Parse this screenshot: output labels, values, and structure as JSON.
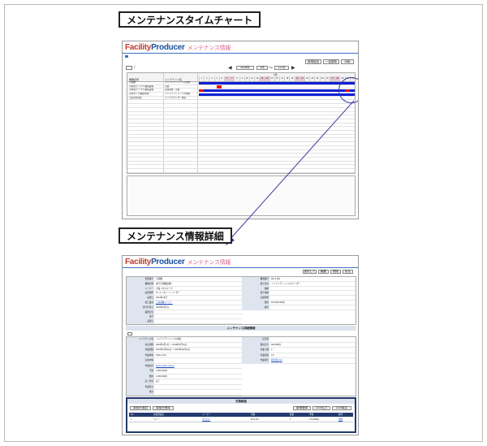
{
  "section1_title": "メンテナンスタイムチャート",
  "section2_title": "メンテナンス情報詳細",
  "app": {
    "brand_a": "Facility",
    "brand_b": "Producer",
    "subtitle": "メンテナンス情報"
  },
  "chart": {
    "buttons": [
      "新規追加",
      "一括更新",
      "印刷"
    ],
    "nav_prev": "◀",
    "nav_next": "▶",
    "year": "2016年",
    "month": "3月",
    "span": "1ヶ月",
    "col_head_name": "機器名称",
    "col_head_type": "メンテナンス名",
    "month_label": "3月",
    "days": [
      "1",
      "2",
      "3",
      "4",
      "5",
      "6",
      "7",
      "8",
      "9",
      "10",
      "11",
      "12",
      "13",
      "14",
      "15",
      "16",
      "17",
      "18",
      "19",
      "20",
      "21",
      "22",
      "23",
      "24",
      "25",
      "26",
      "27",
      "28",
      "29",
      "30",
      "31"
    ],
    "rows": [
      {
        "name": "空調機",
        "type": "インテリアトレッドの交換"
      },
      {
        "name": "冷却塔(アンプル)循環設備",
        "type": "点検"
      },
      {
        "name": "冷却塔(アンプル)循環設備",
        "type": "定期清掃・点検"
      },
      {
        "name": "冷水ポンプ(補給水用)",
        "type": "インテリアトレッドの交換"
      },
      {
        "name": "空調冷却熱源",
        "type": "ライブカウンター交換"
      }
    ]
  },
  "detail": {
    "buttons": [
      "保存して",
      "編集",
      "削除",
      "戻る"
    ],
    "fields_left": [
      {
        "label": "管理番号",
        "value": "空調機"
      },
      {
        "label": "機器名称",
        "value": "本庁空調機設備2"
      },
      {
        "label": "メーカー",
        "value": "大和ハウスワーク"
      },
      {
        "label": "設置場所",
        "value": "1F コーポレートリーダー"
      },
      {
        "label": "設置日",
        "value": "2014年12月"
      },
      {
        "label": "施工業者",
        "value": "三菱電機メーカー"
      },
      {
        "label": "保守年月日",
        "value": "2016年4月1日"
      },
      {
        "label": "業務担当",
        "value": ""
      },
      {
        "label": "設計",
        "value": ""
      },
      {
        "label": "設置日",
        "value": ""
      }
    ],
    "fields_right": [
      {
        "label": "機器番号",
        "value": "MA-3-001"
      },
      {
        "label": "保守担当",
        "value": "インテリアトレッドのリーダー"
      },
      {
        "label": "種類",
        "value": ""
      },
      {
        "label": "保守価格",
        "value": ""
      },
      {
        "label": "点検周期",
        "value": ""
      },
      {
        "label": "費用",
        "value": "150,000,000円"
      },
      {
        "label": "備考",
        "value": ""
      }
    ],
    "mid_header": "メンテナンス詳細情報",
    "mid_fields_left": [
      {
        "label": "メンテナンス名",
        "value": "インテリアトレッドの交換"
      },
      {
        "label": "対応期間",
        "value": "2016年1月1日 〜 2016年1月31日"
      },
      {
        "label": "作業期間",
        "value": "2016年11月20日 〜 2016年11月22日"
      },
      {
        "label": "作業時間",
        "value": "9:00-17:00"
      },
      {
        "label": "実施内容",
        "value": ""
      },
      {
        "label": "作業会社",
        "value": "Future plant system"
      },
      {
        "label": "予算",
        "value": "2,000,000円"
      },
      {
        "label": "費用",
        "value": "2,000,000円"
      },
      {
        "label": "完了状況",
        "value": "完了"
      },
      {
        "label": "作業区分",
        "value": ""
      },
      {
        "label": "備考",
        "value": ""
      }
    ],
    "mid_fields_right": [
      {
        "label": "担当者",
        "value": ""
      },
      {
        "label": "費用合計",
        "value": "400,000円"
      },
      {
        "label": "作業人数",
        "value": "2"
      },
      {
        "label": "作業時間",
        "value": "2.5"
      },
      {
        "label": "作業報告",
        "value": "報告書.docx"
      }
    ],
    "bottom_header": "交換部品",
    "bottom_buttons_left": [
      "部品を追加",
      "部品を削除"
    ],
    "bottom_buttons_right": [
      "新規登録",
      "CSV出力",
      "CSV取込"
    ],
    "table_heads": [
      "No",
      "交換部品名",
      "メーカー",
      "型番",
      "数量",
      "単価",
      "操作"
    ],
    "table_row": {
      "no": "1",
      "name": "リレー",
      "maker": "オムロン",
      "model": "MY2-DC",
      "qty": "1",
      "price": "170,000円",
      "op": "削除"
    }
  }
}
